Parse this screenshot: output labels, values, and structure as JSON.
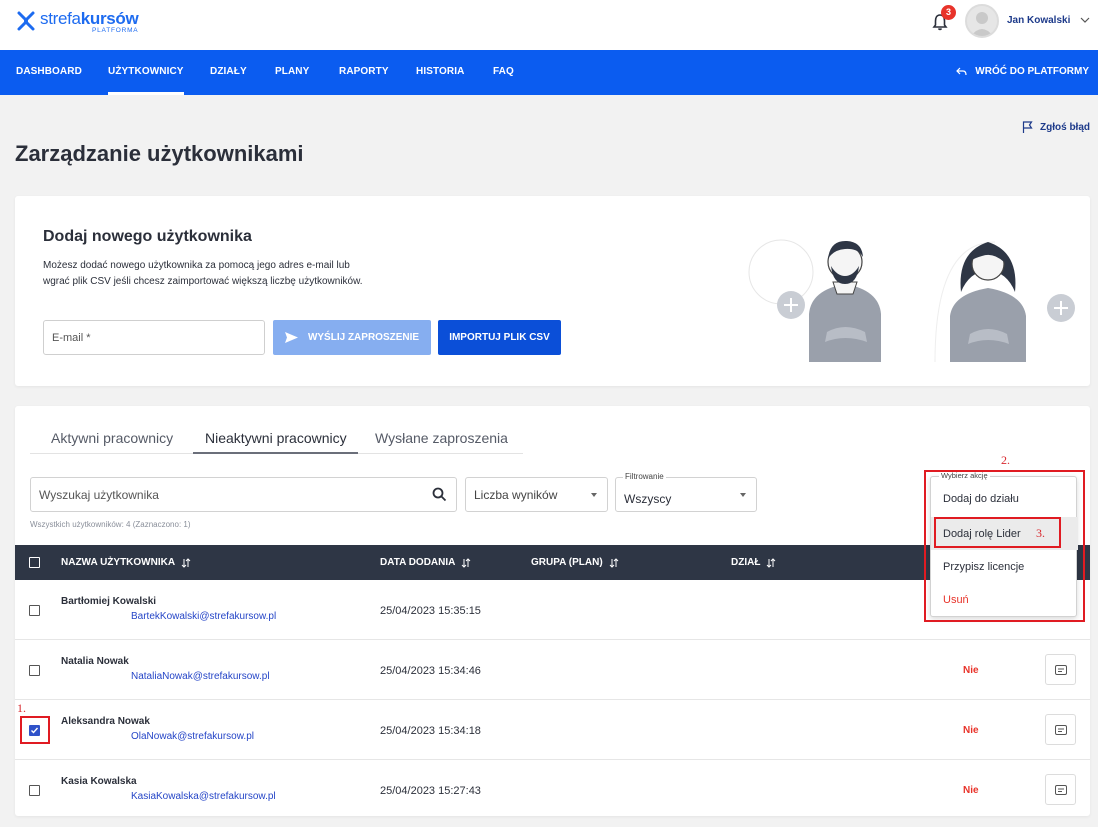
{
  "brand": {
    "name_light": "strefa",
    "name_bold": "kursów",
    "sub": "PLATFORMA",
    "blue": "#0b5cf0"
  },
  "header": {
    "notifications_count": "3",
    "user_name": "Jan Kowalski"
  },
  "nav": {
    "items": [
      {
        "label": "DASHBOARD",
        "active": false
      },
      {
        "label": "UŻYTKOWNICY",
        "active": true
      },
      {
        "label": "DZIAŁY",
        "active": false
      },
      {
        "label": "PLANY",
        "active": false
      },
      {
        "label": "RAPORTY",
        "active": false
      },
      {
        "label": "HISTORIA",
        "active": false
      },
      {
        "label": "FAQ",
        "active": false
      }
    ],
    "back_label": "WRÓĆ DO PLATFORMY"
  },
  "report_bug": "Zgłoś błąd",
  "page_title": "Zarządzanie użytkownikami",
  "add_user": {
    "title": "Dodaj nowego użytkownika",
    "desc_line1": "Możesz dodać nowego użytkownika za pomocą jego adres e-mail lub",
    "desc_line2": "wgrać plik CSV jeśli chcesz zaimportować większą liczbę użytkowników.",
    "email_placeholder": "E-mail *",
    "send_label": "WYŚLIJ ZAPROSZENIE",
    "import_label": "IMPORTUJ PLIK CSV"
  },
  "tabs": [
    {
      "label": "Aktywni pracownicy",
      "active": false
    },
    {
      "label": "Nieaktywni pracownicy",
      "active": true
    },
    {
      "label": "Wysłane zaproszenia",
      "active": false
    }
  ],
  "filters": {
    "search_placeholder": "Wyszukaj użytkownika",
    "limit_label": "Liczba wyników",
    "filter_label": "Filtrowanie",
    "filter_value": "Wszyscy"
  },
  "count_text": "Wszystkich użytkowników: 4 (Zaznaczono: 1)",
  "table": {
    "columns": [
      "NAZWA UŻYTKOWNIKA",
      "DATA DODANIA",
      "GRUPA (PLAN)",
      "DZIAŁ"
    ],
    "rows": [
      {
        "name": "Bartłomiej Kowalski",
        "email": "BartekKowalski@strefakursow.pl",
        "date": "25/04/2023 15:35:15",
        "status": "",
        "checked": false
      },
      {
        "name": "Natalia Nowak",
        "email": "NataliaNowak@strefakursow.pl",
        "date": "25/04/2023 15:34:46",
        "status": "Nie",
        "checked": false
      },
      {
        "name": "Aleksandra Nowak",
        "email": "OlaNowak@strefakursow.pl",
        "date": "25/04/2023 15:34:18",
        "status": "Nie",
        "checked": true
      },
      {
        "name": "Kasia Kowalska",
        "email": "KasiaKowalska@strefakursow.pl",
        "date": "25/04/2023 15:27:43",
        "status": "Nie",
        "checked": false
      }
    ]
  },
  "action_menu": {
    "label": "Wybierz akcję",
    "items": [
      "Dodaj do działu",
      "Dodaj rolę Lider",
      "Przypisz licencje",
      "Usuń"
    ]
  },
  "annotations": {
    "step1": "1.",
    "step2": "2.",
    "step3": "3.",
    "color": "#e01b22"
  }
}
